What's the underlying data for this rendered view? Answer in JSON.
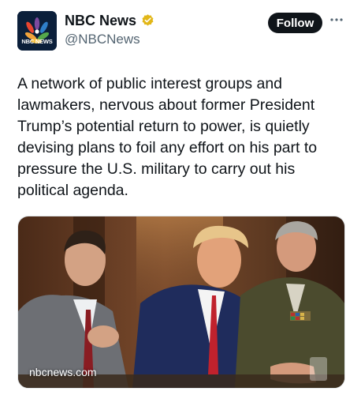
{
  "author": {
    "avatar_label": "NBC NEWS",
    "display_name": "NBC News",
    "handle": "@NBCNews",
    "verified_badge_color": "#e2b719"
  },
  "actions": {
    "follow_label": "Follow",
    "more_icon": "more-horizontal-icon"
  },
  "tweet": {
    "text": "A network of public interest groups and\nlawmakers, nervous about former President\nTrump’s potential return to power, is quietly\ndevising plans to foil any effort on his part to\npressure the U.S. military to carry out his\npolitical agenda."
  },
  "media": {
    "link_domain": "nbcnews.com"
  },
  "colors": {
    "text": "#0f1419",
    "secondary_text": "#536471",
    "button_bg": "#0f1419",
    "button_text": "#ffffff"
  }
}
